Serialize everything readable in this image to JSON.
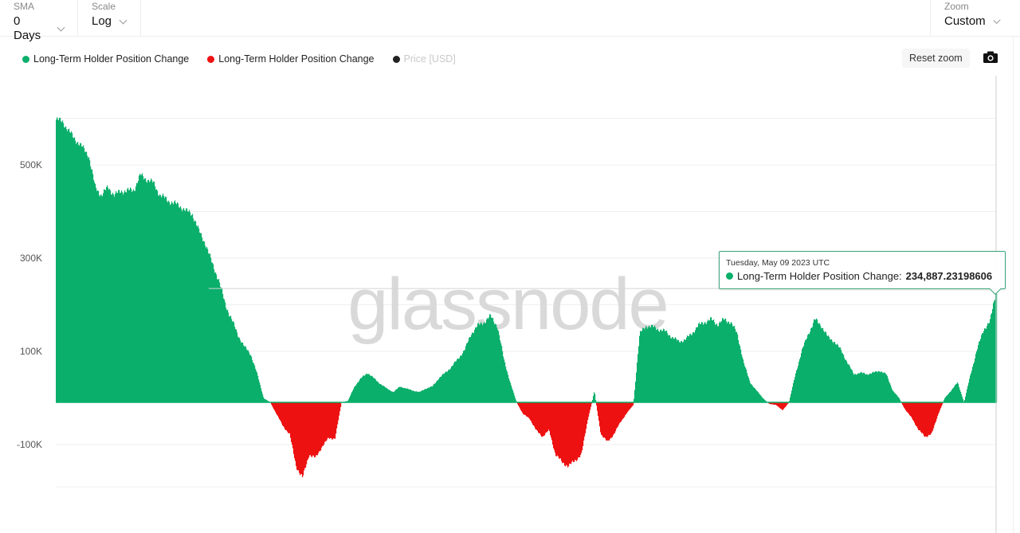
{
  "controls": {
    "sma": {
      "label": "SMA",
      "value": "0 Days"
    },
    "scale": {
      "label": "Scale",
      "value": "Log"
    },
    "zoom": {
      "label": "Zoom",
      "value": "Custom"
    }
  },
  "toolbar": {
    "reset_zoom_label": "Reset zoom",
    "screenshot_icon": "camera-icon"
  },
  "legend": [
    {
      "label": "Long-Term Holder Position Change",
      "color": "#0aaf6b",
      "active": true
    },
    {
      "label": "Long-Term Holder Position Change",
      "color": "#ee1111",
      "active": true
    },
    {
      "label": "Price [USD]",
      "color": "#222222",
      "active": false
    }
  ],
  "watermark": "glassnode",
  "tooltip": {
    "date": "Tuesday, May 09 2023 UTC",
    "series": "Long-Term Holder Position Change:",
    "value": "234,887.23198606",
    "color": "#0aaf6b"
  },
  "colors": {
    "positive": "#0aaf6b",
    "negative": "#ee1111",
    "grid": "#efefef",
    "axis_text": "#555555"
  },
  "chart_data": {
    "type": "area",
    "title": "",
    "xlabel": "",
    "ylabel": "",
    "scale": "log",
    "ytick_labels": [
      "500K",
      "300K",
      "100K",
      "-100K"
    ],
    "yticks": [
      500000,
      300000,
      100000,
      -100000
    ],
    "ylim": [
      -180000,
      600000
    ],
    "grid": true,
    "legend_position": "top-left",
    "series": [
      {
        "name": "Long-Term Holder Position Change",
        "sign": "positive",
        "color": "#0aaf6b"
      },
      {
        "name": "Long-Term Holder Position Change",
        "sign": "negative",
        "color": "#ee1111"
      }
    ],
    "x_index": "time (sequential samples, last point = 2023-05-09)",
    "values_k": [
      597,
      593,
      571,
      554,
      538,
      521,
      452,
      435,
      452,
      435,
      444,
      444,
      447,
      478,
      469,
      461,
      435,
      426,
      418,
      413,
      401,
      395,
      358,
      332,
      290,
      256,
      204,
      170,
      136,
      110,
      94,
      55,
      8,
      0,
      -28,
      -57,
      -75,
      -151,
      -179,
      -123,
      -132,
      -104,
      -85,
      -85,
      0,
      3,
      31,
      47,
      58,
      47,
      36,
      27,
      20,
      31,
      27,
      23,
      20,
      27,
      31,
      47,
      58,
      70,
      86,
      103,
      138,
      155,
      163,
      175,
      155,
      86,
      39,
      0,
      -28,
      -38,
      -66,
      -81,
      -66,
      -123,
      -142,
      -151,
      -138,
      -123,
      -38,
      23,
      -75,
      -94,
      -75,
      -47,
      -25,
      -6,
      138,
      155,
      152,
      147,
      142,
      130,
      121,
      125,
      138,
      155,
      163,
      168,
      158,
      168,
      163,
      138,
      78,
      39,
      23,
      8,
      -4,
      -6,
      -19,
      0,
      55,
      102,
      138,
      168,
      155,
      130,
      121,
      103,
      78,
      55,
      58,
      55,
      58,
      62,
      55,
      23,
      8,
      -19,
      -38,
      -66,
      -81,
      -75,
      -28,
      8,
      23,
      39,
      0,
      55,
      103,
      147,
      163,
      234.887
    ]
  }
}
